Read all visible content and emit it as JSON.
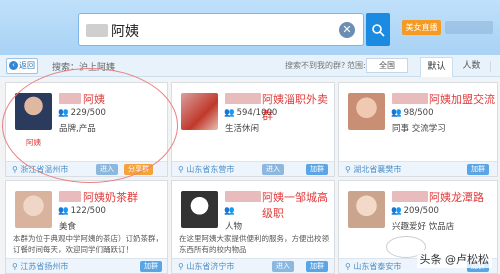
{
  "search": {
    "query": "阿姨",
    "button": "search"
  },
  "topbar": {
    "live_label": "美女直播"
  },
  "toolbar": {
    "back": "返回",
    "crumb": "搜索：沪上阿姨",
    "hint": "搜索不到我的群?",
    "range_label": "范围:",
    "range_value": "全国",
    "tabs": [
      "默认",
      "人数"
    ]
  },
  "cards": [
    {
      "name": "阿姨",
      "count": "229/500",
      "tag": "品牌,产品",
      "desc": "阿姨",
      "location": "浙江省温州市",
      "enter": "进入",
      "share": "分享群",
      "join": ""
    },
    {
      "name": "阿姨淄职外卖群",
      "count": "594/1000",
      "tag": "生活休闲",
      "desc": "",
      "location": "山东省东营市",
      "enter": "进入",
      "share": "",
      "join": "加群"
    },
    {
      "name": "阿姨加盟交流",
      "count": "98/500",
      "tag": "同事  交流学习",
      "desc": "",
      "location": "湖北省襄樊市",
      "enter": "",
      "share": "",
      "join": "加群"
    },
    {
      "name": "阿姨奶茶群",
      "count": "122/500",
      "tag": "美食",
      "desc": "本群为位于典观中学阿姨的茶店）订奶茶群，订餐时间每天，欢迎同学们踊跃订！",
      "location": "江苏省扬州市",
      "enter": "",
      "share": "",
      "join": "加群"
    },
    {
      "name": "阿姨一邹城高级职",
      "count": "",
      "tag": "人物",
      "desc": "在这里阿姨大家提供便利的服务，方便出校领东西所有的校内物品",
      "location": "山东省济宁市",
      "enter": "进入",
      "share": "",
      "join": "加群"
    },
    {
      "name": "阿姨龙潭路",
      "count": "209/500",
      "tag": "兴趣爱好  饮品店",
      "desc": "",
      "location": "山东省泰安市",
      "enter": "",
      "share": "",
      "join": "加群"
    }
  ],
  "watermark": "头条 @卢松松",
  "colors": {
    "accent": "#1a8be0",
    "name_red": "#e03a3a",
    "live_orange": "#f59a23"
  }
}
